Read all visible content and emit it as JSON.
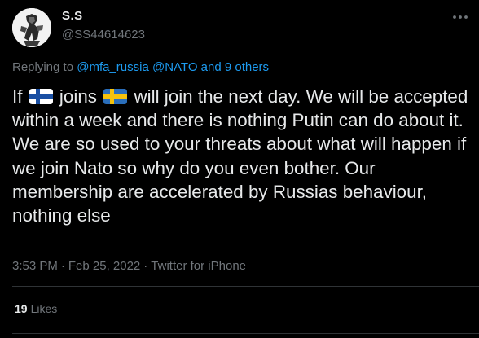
{
  "author": {
    "display_name": "S.S",
    "handle": "@SS44614623",
    "avatar_icon": "avatar-figure-icon",
    "more_icon": "more-options-icon"
  },
  "reply_context": {
    "prefix": "Replying to",
    "mentions": "@mfa_russia @NATO and 9 others"
  },
  "tweet": {
    "text_before_flag_1": "If",
    "flag_1": "finland-flag-icon",
    "text_between_flags": "joins",
    "flag_2": "sweden-flag-icon",
    "text_after_flags": "will join the next day. We will be accepted within a week and there is nothing Putin can do about it.",
    "paragraph_2": "We are so used to your threats about what will happen if we join Nato so why do you even bother. Our membership are accelerated by Russias behaviour, nothing else"
  },
  "meta": {
    "time": "3:53 PM",
    "date": "Feb 25, 2022",
    "source": "Twitter for iPhone",
    "separator": "·"
  },
  "stats": {
    "likes_count": "19",
    "likes_label": "Likes"
  },
  "colors": {
    "background": "#000000",
    "text_primary": "#e7e9ea",
    "text_secondary": "#71767b",
    "link": "#1d9bf0",
    "divider": "#2f3336"
  }
}
